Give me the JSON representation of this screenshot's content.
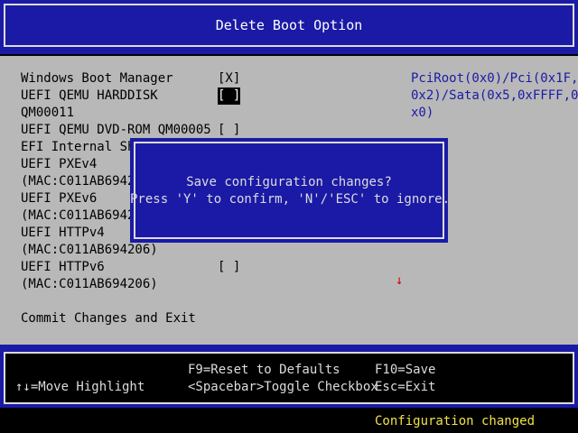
{
  "title": "Delete Boot Option",
  "options": [
    {
      "label": "Windows Boot Manager",
      "checkbox": "[X]",
      "highlighted": false
    },
    {
      "label": "UEFI QEMU HARDDISK",
      "label2": "QM00011",
      "checkbox": "[ ]",
      "highlighted": true
    },
    {
      "label": "UEFI QEMU DVD-ROM QM00005",
      "checkbox": "[ ]",
      "highlighted": false
    },
    {
      "label": "EFI Internal Sh",
      "checkbox": "",
      "highlighted": false
    },
    {
      "label": "UEFI PXEv4",
      "label2": "(MAC:C011AB6942",
      "checkbox": "",
      "highlighted": false
    },
    {
      "label": "UEFI PXEv6",
      "label2": "(MAC:C011AB6942",
      "checkbox": "",
      "highlighted": false
    },
    {
      "label": "UEFI HTTPv4",
      "label2": "(MAC:C011AB694206)",
      "checkbox": "",
      "highlighted": false
    },
    {
      "label": "UEFI HTTPv6",
      "label2": "(MAC:C011AB694206)",
      "checkbox": "[ ]",
      "highlighted": false
    }
  ],
  "commit_label": "Commit Changes and Exit",
  "help_lines": [
    "PciRoot(0x0)/Pci(0x1F,",
    "0x2)/Sata(0x5,0xFFFF,0",
    "x0)"
  ],
  "arrow_glyph": "↓",
  "dialog": {
    "line1": "Save configuration changes?",
    "line2": "Press 'Y' to confirm, 'N'/'ESC' to ignore."
  },
  "hints": {
    "move": "↑↓=Move Highlight",
    "reset": "F9=Reset to Defaults",
    "toggle": "<Spacebar>Toggle Checkbox",
    "save": "F10=Save",
    "exit": "Esc=Exit"
  },
  "status": "Configuration changed",
  "colors": {
    "frame_blue": "#1a1aa6",
    "panel_gray": "#b8b8b8",
    "status_yellow": "#f2e14a",
    "arrow_red": "#d40000"
  }
}
